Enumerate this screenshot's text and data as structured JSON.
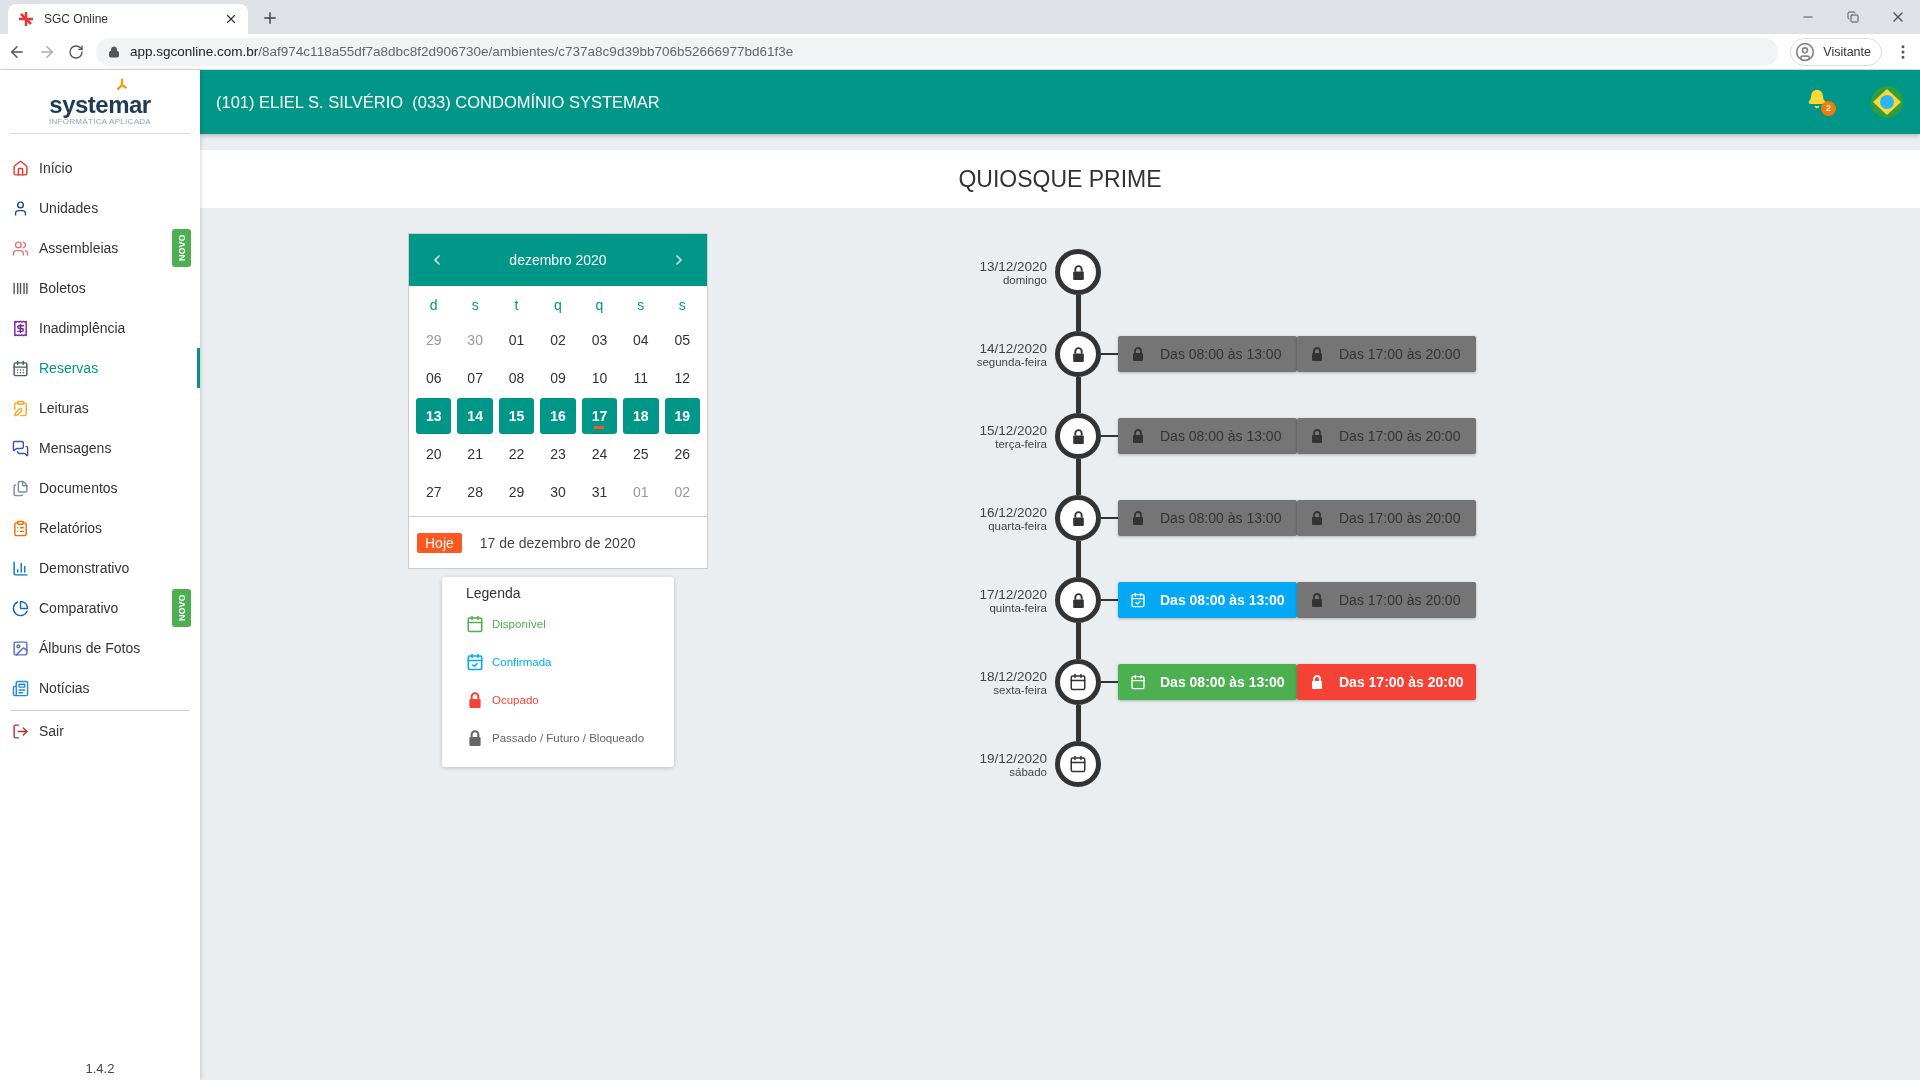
{
  "browser": {
    "tab_title": "SGC Online",
    "url_domain": "app.sgconline.com.br",
    "url_path": "/8af974c118a55df7a8dbc8f2d906730e/ambientes/c737a8c9d39bb706b52666977bd61f3e",
    "profile": "Visitante"
  },
  "header": {
    "title": "(101) ELIEL S. SILVÉRIO  (033) CONDOMÍNIO SYSTEMAR",
    "notifications": "2"
  },
  "sidebar": {
    "logo": "systemar",
    "tagline": "INFORMÁTICA APLICADA",
    "items": [
      {
        "label": "Início",
        "selected": false
      },
      {
        "label": "Unidades",
        "selected": false
      },
      {
        "label": "Assembleias",
        "selected": false,
        "badge": "NOVO"
      },
      {
        "label": "Boletos",
        "selected": false
      },
      {
        "label": "Inadimplência",
        "selected": false
      },
      {
        "label": "Reservas",
        "selected": true
      },
      {
        "label": "Leituras",
        "selected": false
      },
      {
        "label": "Mensagens",
        "selected": false
      },
      {
        "label": "Documentos",
        "selected": false
      },
      {
        "label": "Relatórios",
        "selected": false
      },
      {
        "label": "Demonstrativo",
        "selected": false
      },
      {
        "label": "Comparativo",
        "selected": false,
        "badge": "NOVO"
      },
      {
        "label": "Álbuns de Fotos",
        "selected": false
      },
      {
        "label": "Notícias",
        "selected": false
      }
    ],
    "logout": "Sair",
    "version": "1.4.2"
  },
  "page_title": "QUIOSQUE PRIME",
  "calendar": {
    "month": "dezembro 2020",
    "weekdays": [
      "d",
      "s",
      "t",
      "q",
      "q",
      "s",
      "s"
    ],
    "days": [
      {
        "label": "29",
        "kind": "other"
      },
      {
        "label": "30",
        "kind": "other"
      },
      {
        "label": "01",
        "kind": "current"
      },
      {
        "label": "02",
        "kind": "current"
      },
      {
        "label": "03",
        "kind": "current"
      },
      {
        "label": "04",
        "kind": "current"
      },
      {
        "label": "05",
        "kind": "current"
      },
      {
        "label": "06",
        "kind": "current"
      },
      {
        "label": "07",
        "kind": "current"
      },
      {
        "label": "08",
        "kind": "current"
      },
      {
        "label": "09",
        "kind": "current"
      },
      {
        "label": "10",
        "kind": "current"
      },
      {
        "label": "11",
        "kind": "current"
      },
      {
        "label": "12",
        "kind": "current"
      },
      {
        "label": "13",
        "kind": "week"
      },
      {
        "label": "14",
        "kind": "week"
      },
      {
        "label": "15",
        "kind": "week"
      },
      {
        "label": "16",
        "kind": "week"
      },
      {
        "label": "17",
        "kind": "week",
        "today": true
      },
      {
        "label": "18",
        "kind": "week"
      },
      {
        "label": "19",
        "kind": "week"
      },
      {
        "label": "20",
        "kind": "current"
      },
      {
        "label": "21",
        "kind": "current"
      },
      {
        "label": "22",
        "kind": "current"
      },
      {
        "label": "23",
        "kind": "current"
      },
      {
        "label": "24",
        "kind": "current"
      },
      {
        "label": "25",
        "kind": "current"
      },
      {
        "label": "26",
        "kind": "current"
      },
      {
        "label": "27",
        "kind": "current"
      },
      {
        "label": "28",
        "kind": "current"
      },
      {
        "label": "29",
        "kind": "current"
      },
      {
        "label": "30",
        "kind": "current"
      },
      {
        "label": "31",
        "kind": "current"
      },
      {
        "label": "01",
        "kind": "other"
      },
      {
        "label": "02",
        "kind": "other"
      }
    ],
    "today_badge": "Hoje",
    "today_text": "17 de dezembro de 2020"
  },
  "legend": {
    "title": "Legenda",
    "items": [
      {
        "label": "Disponível",
        "kind": "available"
      },
      {
        "label": "Confirmada",
        "kind": "confirmed"
      },
      {
        "label": "Ocupado",
        "kind": "occupied"
      },
      {
        "label": "Passado / Futuro / Bloqueado",
        "kind": "blocked"
      }
    ]
  },
  "timeline": [
    {
      "date": "13/12/2020",
      "weekday": "domingo",
      "kind": "blocked"
    },
    {
      "date": "14/12/2020",
      "weekday": "segunda-feira",
      "kind": "blocked",
      "slots": [
        {
          "label": "Das 08:00 às 13:00",
          "kind": "blocked"
        },
        {
          "label": "Das 17:00 às 20:00",
          "kind": "blocked"
        }
      ]
    },
    {
      "date": "15/12/2020",
      "weekday": "terça-feira",
      "kind": "blocked",
      "slots": [
        {
          "label": "Das 08:00 às 13:00",
          "kind": "blocked"
        },
        {
          "label": "Das 17:00 às 20:00",
          "kind": "blocked"
        }
      ]
    },
    {
      "date": "16/12/2020",
      "weekday": "quarta-feira",
      "kind": "blocked",
      "slots": [
        {
          "label": "Das 08:00 às 13:00",
          "kind": "blocked"
        },
        {
          "label": "Das 17:00 às 20:00",
          "kind": "blocked"
        }
      ]
    },
    {
      "date": "17/12/2020",
      "weekday": "quinta-feira",
      "kind": "blocked",
      "slots": [
        {
          "label": "Das 08:00 às 13:00",
          "kind": "confirmed"
        },
        {
          "label": "Das 17:00 às 20:00",
          "kind": "blocked"
        }
      ]
    },
    {
      "date": "18/12/2020",
      "weekday": "sexta-feira",
      "kind": "available",
      "slots": [
        {
          "label": "Das 08:00 às 13:00",
          "kind": "available"
        },
        {
          "label": "Das 17:00 às 20:00",
          "kind": "occupied"
        }
      ]
    },
    {
      "date": "19/12/2020",
      "weekday": "sábado",
      "kind": "available"
    }
  ]
}
